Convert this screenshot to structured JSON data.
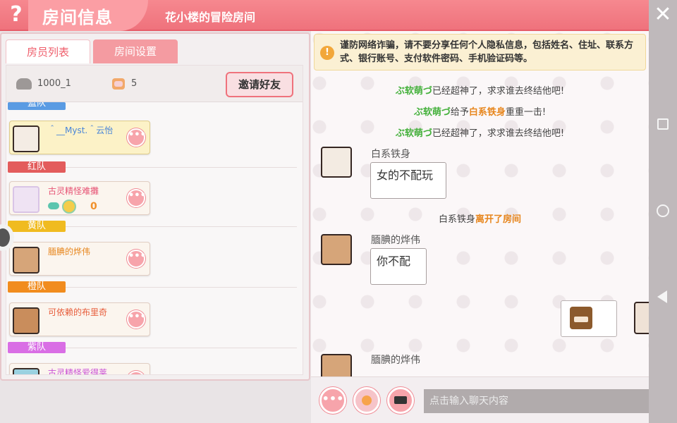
{
  "header": {
    "help_icon": "?",
    "title": "房间信息",
    "room_name": "花小楼的冒险房间",
    "close_icon": "✕"
  },
  "tabs": [
    "房员列表",
    "房间设置"
  ],
  "room": {
    "id": "1000_1",
    "member_count": "5",
    "invite_label": "邀请好友"
  },
  "teams": [
    {
      "label": "蓝队",
      "color": "#5a9be3",
      "members": [
        {
          "name": "＾__Myst.＾云怡",
          "name_color": "#4a86d8"
        }
      ]
    },
    {
      "label": "红队",
      "color": "#e35c5c",
      "members": [
        {
          "name": "古灵精怪难攤",
          "name_color": "#e75576",
          "score": "0"
        }
      ]
    },
    {
      "label": "黄队",
      "color": "#f0bb20",
      "members": [
        {
          "name": "腼腆的烨伟",
          "name_color": "#e7861d"
        }
      ]
    },
    {
      "label": "橙队",
      "color": "#f18c1e",
      "members": [
        {
          "name": "可依赖的布里奇",
          "name_color": "#e75c3a"
        }
      ]
    },
    {
      "label": "紫队",
      "color": "#d96ee5",
      "members": [
        {
          "name": "古灵精怪爱得莱",
          "name_color": "#c94fd6"
        }
      ]
    }
  ],
  "member_more_label": "•••",
  "notice": {
    "icon": "!",
    "text": "谨防网络诈骗，请不要分享任何个人隐私信息，包括姓名、住址、联系方式、银行账号、支付软件密码、手机验证码等。"
  },
  "chat": {
    "sys1": {
      "who": "ぶ软萌づ",
      "rest": "已经超神了，求求谁去终结他吧!"
    },
    "sys2": {
      "who": "ぶ软萌づ",
      "mid": "给予",
      "target": "白系铁身",
      "rest": "重重一击!"
    },
    "sys3": {
      "who": "ぶ软萌づ",
      "rest": "已经超神了，求求谁去终结他吧!"
    },
    "msg1": {
      "name": "白系铁身",
      "text": "女的不配玩"
    },
    "sys4": {
      "who": "白系铁身",
      "rest": "离开了房间"
    },
    "msg2": {
      "name": "腼腆的烨伟",
      "text": "你不配"
    },
    "msg3": {
      "name": "腼腆的烨伟"
    }
  },
  "chat_bar": {
    "more_icon": "•••",
    "input_placeholder": "点击输入聊天内容"
  }
}
